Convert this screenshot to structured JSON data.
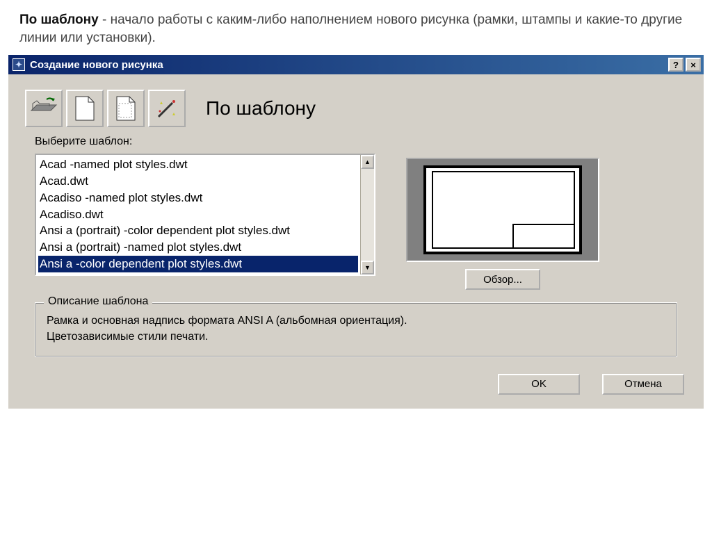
{
  "page": {
    "intro_bold": "По шаблону",
    "intro_rest": " - начало работы с каким-либо наполнением нового рисунка (рамки, штампы и какие-то другие линии или установки)."
  },
  "titlebar": {
    "title": "Создание нового рисунка",
    "help_label": "?",
    "close_label": "×"
  },
  "mode": {
    "title": "По шаблону"
  },
  "template": {
    "select_label": "Выберите шаблон:",
    "items": [
      "Acad -named plot styles.dwt",
      "Acad.dwt",
      "Acadiso -named plot styles.dwt",
      "Acadiso.dwt",
      "Ansi a (portrait) -color dependent plot styles.dwt",
      "Ansi a (portrait) -named plot styles.dwt",
      "Ansi a -color dependent plot styles.dwt"
    ],
    "selected_index": 6,
    "browse_label": "Обзор..."
  },
  "description": {
    "group_label": "Описание шаблона",
    "line1": "Рамка и основная надпись формата ANSI A (альбомная ориентация).",
    "line2": "Цветозависимые стили печати."
  },
  "footer": {
    "ok_label": "OK",
    "cancel_label": "Отмена"
  }
}
